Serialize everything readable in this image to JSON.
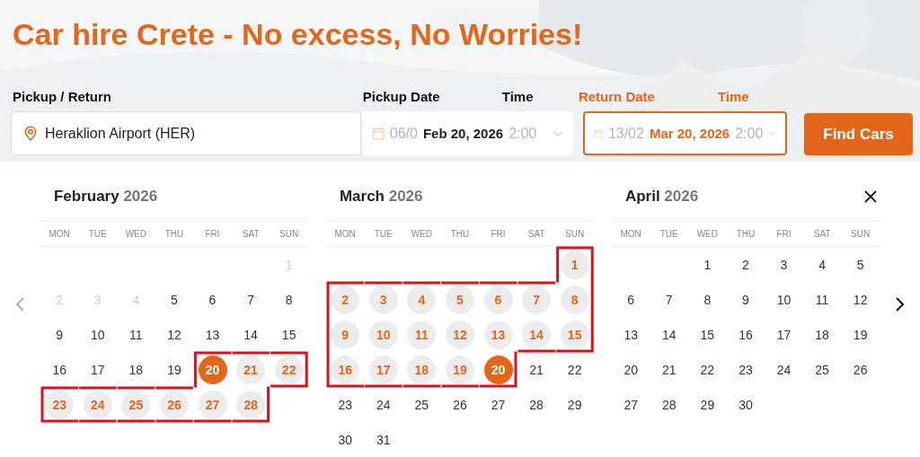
{
  "page_title": "Car hire Crete - No excess, No Worries!",
  "search": {
    "location": {
      "label": "Pickup / Return",
      "value": "Heraklion Airport (HER)"
    },
    "pickup": {
      "date_label": "Pickup Date",
      "time_label": "Time",
      "faded_date": "06/0",
      "value": "Feb 20, 2026",
      "faded_time": "2:00",
      "active": false
    },
    "return": {
      "date_label": "Return Date",
      "time_label": "Time",
      "faded_date": "13/02",
      "value": "Mar 20, 2026",
      "faded_time": "2:00",
      "active": true
    },
    "button": "Find Cars"
  },
  "calendar": {
    "range_outlined": true,
    "months": [
      {
        "name": "February",
        "year": "2026",
        "weekdays": [
          "MON",
          "TUE",
          "WED",
          "THU",
          "FRI",
          "SAT",
          "SUN"
        ],
        "weeks": [
          [
            {
              "kind": "blank"
            },
            {
              "kind": "blank"
            },
            {
              "kind": "blank"
            },
            {
              "kind": "blank"
            },
            {
              "kind": "blank"
            },
            {
              "kind": "blank"
            },
            {
              "kind": "past",
              "label": "1"
            }
          ],
          [
            {
              "kind": "past",
              "label": "2"
            },
            {
              "kind": "past",
              "label": "3"
            },
            {
              "kind": "past",
              "label": "4"
            },
            {
              "kind": "day",
              "label": "5"
            },
            {
              "kind": "day",
              "label": "6"
            },
            {
              "kind": "day",
              "label": "7"
            },
            {
              "kind": "day",
              "label": "8"
            }
          ],
          [
            {
              "kind": "day",
              "label": "9"
            },
            {
              "kind": "day",
              "label": "10"
            },
            {
              "kind": "day",
              "label": "11"
            },
            {
              "kind": "day",
              "label": "12"
            },
            {
              "kind": "day",
              "label": "13"
            },
            {
              "kind": "day",
              "label": "14"
            },
            {
              "kind": "day",
              "label": "15"
            }
          ],
          [
            {
              "kind": "day",
              "label": "16"
            },
            {
              "kind": "day",
              "label": "17"
            },
            {
              "kind": "day",
              "label": "18"
            },
            {
              "kind": "day",
              "label": "19"
            },
            {
              "kind": "endpoint",
              "label": "20"
            },
            {
              "kind": "range",
              "label": "21"
            },
            {
              "kind": "range",
              "label": "22"
            }
          ],
          [
            {
              "kind": "range",
              "label": "23"
            },
            {
              "kind": "range",
              "label": "24"
            },
            {
              "kind": "range",
              "label": "25"
            },
            {
              "kind": "range",
              "label": "26"
            },
            {
              "kind": "range",
              "label": "27"
            },
            {
              "kind": "range",
              "label": "28"
            }
          ]
        ]
      },
      {
        "name": "March",
        "year": "2026",
        "weekdays": [
          "MON",
          "TUE",
          "WED",
          "THU",
          "FRI",
          "SAT",
          "SUN"
        ],
        "weeks": [
          [
            {
              "kind": "blank"
            },
            {
              "kind": "blank"
            },
            {
              "kind": "blank"
            },
            {
              "kind": "blank"
            },
            {
              "kind": "blank"
            },
            {
              "kind": "blank"
            },
            {
              "kind": "range",
              "label": "1"
            }
          ],
          [
            {
              "kind": "range",
              "label": "2"
            },
            {
              "kind": "range",
              "label": "3"
            },
            {
              "kind": "range",
              "label": "4"
            },
            {
              "kind": "range",
              "label": "5"
            },
            {
              "kind": "range",
              "label": "6"
            },
            {
              "kind": "range",
              "label": "7"
            },
            {
              "kind": "range",
              "label": "8"
            }
          ],
          [
            {
              "kind": "range",
              "label": "9"
            },
            {
              "kind": "range",
              "label": "10"
            },
            {
              "kind": "range",
              "label": "11"
            },
            {
              "kind": "range",
              "label": "12"
            },
            {
              "kind": "range",
              "label": "13"
            },
            {
              "kind": "range",
              "label": "14"
            },
            {
              "kind": "range",
              "label": "15"
            }
          ],
          [
            {
              "kind": "range",
              "label": "16"
            },
            {
              "kind": "range",
              "label": "17"
            },
            {
              "kind": "range",
              "label": "18"
            },
            {
              "kind": "range",
              "label": "19"
            },
            {
              "kind": "endpoint",
              "label": "20"
            },
            {
              "kind": "day",
              "label": "21"
            },
            {
              "kind": "day",
              "label": "22"
            }
          ],
          [
            {
              "kind": "day",
              "label": "23"
            },
            {
              "kind": "day",
              "label": "24"
            },
            {
              "kind": "day",
              "label": "25"
            },
            {
              "kind": "day",
              "label": "26"
            },
            {
              "kind": "day",
              "label": "27"
            },
            {
              "kind": "day",
              "label": "28"
            },
            {
              "kind": "day",
              "label": "29"
            }
          ],
          [
            {
              "kind": "day",
              "label": "30"
            },
            {
              "kind": "day",
              "label": "31"
            }
          ]
        ]
      },
      {
        "name": "April",
        "year": "2026",
        "weekdays": [
          "MON",
          "TUE",
          "WED",
          "THU",
          "FRI",
          "SAT",
          "SUN"
        ],
        "weeks": [
          [
            {
              "kind": "blank"
            },
            {
              "kind": "blank"
            },
            {
              "kind": "day",
              "label": "1"
            },
            {
              "kind": "day",
              "label": "2"
            },
            {
              "kind": "day",
              "label": "3"
            },
            {
              "kind": "day",
              "label": "4"
            },
            {
              "kind": "day",
              "label": "5"
            }
          ],
          [
            {
              "kind": "day",
              "label": "6"
            },
            {
              "kind": "day",
              "label": "7"
            },
            {
              "kind": "day",
              "label": "8"
            },
            {
              "kind": "day",
              "label": "9"
            },
            {
              "kind": "day",
              "label": "10"
            },
            {
              "kind": "day",
              "label": "11"
            },
            {
              "kind": "day",
              "label": "12"
            }
          ],
          [
            {
              "kind": "day",
              "label": "13"
            },
            {
              "kind": "day",
              "label": "14"
            },
            {
              "kind": "day",
              "label": "15"
            },
            {
              "kind": "day",
              "label": "16"
            },
            {
              "kind": "day",
              "label": "17"
            },
            {
              "kind": "day",
              "label": "18"
            },
            {
              "kind": "day",
              "label": "19"
            }
          ],
          [
            {
              "kind": "day",
              "label": "20"
            },
            {
              "kind": "day",
              "label": "21"
            },
            {
              "kind": "day",
              "label": "22"
            },
            {
              "kind": "day",
              "label": "23"
            },
            {
              "kind": "day",
              "label": "24"
            },
            {
              "kind": "day",
              "label": "25"
            },
            {
              "kind": "day",
              "label": "26"
            }
          ],
          [
            {
              "kind": "day",
              "label": "27"
            },
            {
              "kind": "day",
              "label": "28"
            },
            {
              "kind": "day",
              "label": "29"
            },
            {
              "kind": "day",
              "label": "30"
            }
          ]
        ]
      }
    ]
  }
}
